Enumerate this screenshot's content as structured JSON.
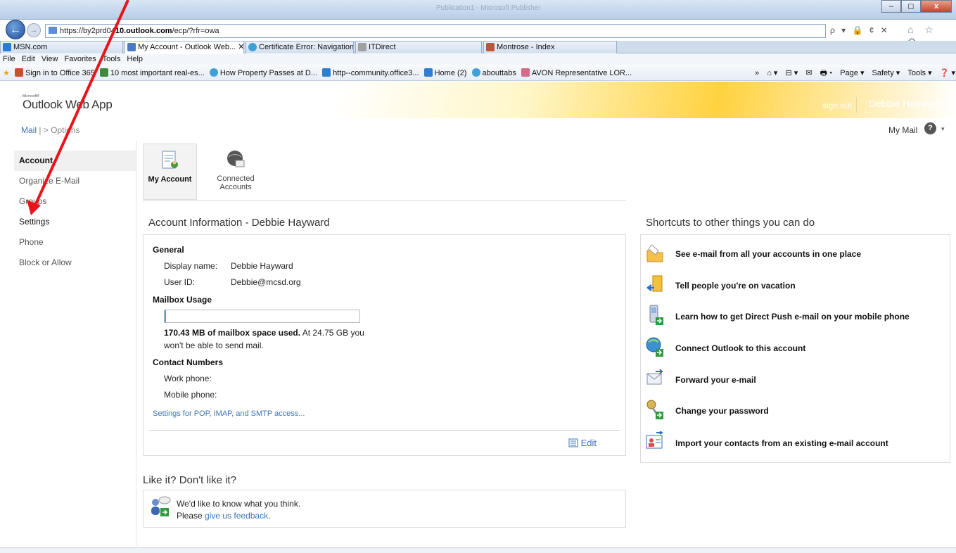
{
  "browser": {
    "title": "Publication1 - Microsoft Publisher",
    "address": {
      "prefix": "https://by2prd04",
      "domain": "10.outlook.com",
      "path": "/ecp/?rfr=owa"
    },
    "address_controls": "ρ ▾ 🔒 ¢ ✕",
    "nav_icons": "⌂ ☆ ⚙",
    "tabs": [
      {
        "label": "MSN.com"
      },
      {
        "label": "My Account - Outlook Web... ✕"
      },
      {
        "label": "Certificate Error: Navigation Bl..."
      },
      {
        "label": "ITDirect"
      },
      {
        "label": "Montrose - Index"
      }
    ],
    "menu": [
      "File",
      "Edit",
      "View",
      "Favorites",
      "Tools",
      "Help"
    ],
    "favorites": [
      {
        "label": "Sign in to Office 365"
      },
      {
        "label": "10 most important real-es..."
      },
      {
        "label": "How Property Passes at D..."
      },
      {
        "label": "http--community.office3..."
      },
      {
        "label": "Home (2)"
      },
      {
        "label": "abouttabs"
      },
      {
        "label": "AVON Representative LOR..."
      }
    ],
    "command_bar": [
      "»",
      "⌂ ▾",
      "⊟ ▾",
      "✉",
      "🖶 ▾",
      "Page ▾",
      "Safety ▾",
      "Tools ▾",
      "❓ ▾",
      "👥"
    ],
    "colors": {
      "accent": "#3d74b6",
      "banner": "#ffd23f"
    }
  },
  "owa": {
    "logo_small": "Microsoft®",
    "logo": "Outlook Web App",
    "sign_out": "sign out",
    "user": "Debbie Hayward",
    "breadcrumb": {
      "mail": "Mail",
      "sep": "| >",
      "current": "Options"
    },
    "my_mail": "My Mail",
    "help": "?",
    "help_dd": "▾"
  },
  "nav": [
    {
      "label": "Account"
    },
    {
      "label": "Organize E-Mail"
    },
    {
      "label": "Groups"
    },
    {
      "label": "Settings"
    },
    {
      "label": "Phone"
    },
    {
      "label": "Block or Allow"
    }
  ],
  "tabs": {
    "my_account": "My Account",
    "connected": "Connected Accounts"
  },
  "account": {
    "heading": "Account Information - Debbie Hayward",
    "general": "General",
    "display_name_label": "Display name:",
    "display_name": "Debbie Hayward",
    "user_id_label": "User ID:",
    "user_id": "Debbie@mcsd.org",
    "mailbox_usage": "Mailbox Usage",
    "usage_fraction": 0.007,
    "usage_bold": "170.43 MB of mailbox space used.",
    "usage_rest": " At 24.75 GB you",
    "usage_line2": "won't be able to send mail.",
    "contact_numbers": "Contact Numbers",
    "work_phone": "Work phone:",
    "mobile_phone": "Mobile phone:",
    "pop_link": "Settings for POP, IMAP, and SMTP access...",
    "edit": "Edit"
  },
  "feedback": {
    "heading": "Like it? Don't like it?",
    "line1": "We'd like to know what you think.",
    "line2_pre": "Please ",
    "line2_link": "give us feedback",
    "line2_post": "."
  },
  "shortcuts": {
    "heading": "Shortcuts to other things you can do",
    "items": [
      {
        "label": "See e-mail from all your accounts in one place",
        "icon": "folder-mail-icon"
      },
      {
        "label": "Tell people you're on vacation",
        "icon": "vacation-door-icon"
      },
      {
        "label": "Learn how to get Direct Push e-mail on your mobile phone",
        "icon": "mobile-phone-icon"
      },
      {
        "label": "Connect Outlook to this account",
        "icon": "outlook-globe-icon"
      },
      {
        "label": "Forward your e-mail",
        "icon": "forward-mail-icon"
      },
      {
        "label": "Change your password",
        "icon": "keys-icon"
      },
      {
        "label": "Import your contacts from an existing e-mail account",
        "icon": "contact-card-icon"
      }
    ]
  }
}
